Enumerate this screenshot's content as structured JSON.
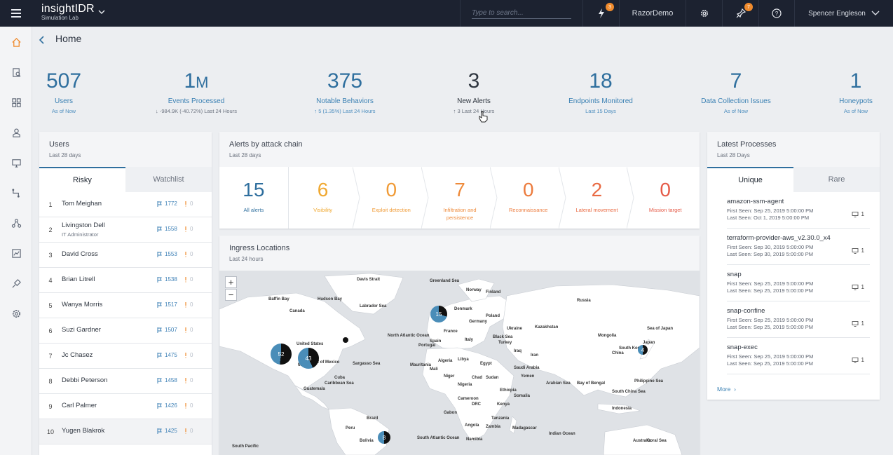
{
  "topbar": {
    "brand_name": "insightIDR",
    "brand_sub": "Simulation Lab",
    "search_placeholder": "Type to search...",
    "alerts_badge": "3",
    "org_name": "RazorDemo",
    "tasks_badge": "7",
    "user_name": "Spencer Engleson"
  },
  "page": {
    "title": "Home"
  },
  "stats": [
    {
      "value": "507",
      "unit": "",
      "label": "Users",
      "sub": "As of Now"
    },
    {
      "value": "1",
      "unit": "M",
      "label": "Events Processed",
      "sub": "↓ -984.9K (-40.72%)   Last 24 Hours"
    },
    {
      "value": "375",
      "unit": "",
      "label": "Notable Behaviors",
      "sub": "↑ 5 (1.35%)   Last 24 Hours"
    },
    {
      "value": "3",
      "unit": "",
      "label": "New Alerts",
      "sub": "↑ 3   Last 24 Hours"
    },
    {
      "value": "18",
      "unit": "",
      "label": "Endpoints Monitored",
      "sub": "Last 15 Days"
    },
    {
      "value": "7",
      "unit": "",
      "label": "Data Collection Issues",
      "sub": "As of Now"
    },
    {
      "value": "1",
      "unit": "",
      "label": "Honeypots",
      "sub": "As of Now"
    }
  ],
  "users_card": {
    "title": "Users",
    "sub": "Last 28 days",
    "tab_risky": "Risky",
    "tab_watchlist": "Watchlist",
    "rows": [
      {
        "idx": "1",
        "name": "Tom Meighan",
        "role": "",
        "flags": "1772",
        "alerts": "0"
      },
      {
        "idx": "2",
        "name": "Livingston Dell",
        "role": "IT Administrator",
        "flags": "1558",
        "alerts": "0"
      },
      {
        "idx": "3",
        "name": "David Cross",
        "role": "",
        "flags": "1553",
        "alerts": "0"
      },
      {
        "idx": "4",
        "name": "Brian Litrell",
        "role": "",
        "flags": "1538",
        "alerts": "0"
      },
      {
        "idx": "5",
        "name": "Wanya Morris",
        "role": "",
        "flags": "1517",
        "alerts": "0"
      },
      {
        "idx": "6",
        "name": "Suzi Gardner",
        "role": "",
        "flags": "1507",
        "alerts": "0"
      },
      {
        "idx": "7",
        "name": "Jc Chasez",
        "role": "",
        "flags": "1475",
        "alerts": "0"
      },
      {
        "idx": "8",
        "name": "Debbi Peterson",
        "role": "",
        "flags": "1458",
        "alerts": "0"
      },
      {
        "idx": "9",
        "name": "Carl Palmer",
        "role": "",
        "flags": "1426",
        "alerts": "0"
      },
      {
        "idx": "10",
        "name": "Yugen Blakrok",
        "role": "",
        "flags": "1425",
        "alerts": "0"
      }
    ]
  },
  "attack_chain": {
    "title": "Alerts by attack chain",
    "sub": "Last 28 days",
    "items": [
      {
        "count": "15",
        "label": "All alerts",
        "color": "#2f6f9e"
      },
      {
        "count": "6",
        "label": "Visibility",
        "color": "#f0a830"
      },
      {
        "count": "0",
        "label": "Exploit detection",
        "color": "#f09a35"
      },
      {
        "count": "7",
        "label": "Infiltration and persistence",
        "color": "#ee8a3a"
      },
      {
        "count": "0",
        "label": "Reconnaissance",
        "color": "#ec7b3d"
      },
      {
        "count": "2",
        "label": "Lateral movement",
        "color": "#e96a42"
      },
      {
        "count": "0",
        "label": "Mission target",
        "color": "#e55a47"
      }
    ]
  },
  "ingress": {
    "title": "Ingress Locations",
    "sub": "Last 24 hours",
    "zoom_in": "+",
    "zoom_out": "−",
    "clusters": [
      {
        "count": "52"
      },
      {
        "count": "43"
      },
      {
        "count": "15"
      },
      {
        "count": "4"
      },
      {
        "count": "8"
      }
    ],
    "labels": [
      "Davis Strait",
      "Baffin Bay",
      "Hudson Bay",
      "Labrador Sea",
      "Canada",
      "North Atlantic Ocean",
      "United States",
      "Mexico",
      "Gulf of Mexico",
      "Sargasso Sea",
      "Caribbean Sea",
      "Brazil",
      "Peru",
      "Bolivia",
      "Greenland Sea",
      "Norway",
      "Finland",
      "Denmark",
      "Germany",
      "Poland",
      "Ukraine",
      "France",
      "Spain",
      "Italy",
      "Turkey",
      "Kazakhstan",
      "Russia",
      "Mongolia",
      "China",
      "Iran",
      "Iraq",
      "Egypt",
      "Libya",
      "Algeria",
      "Niger",
      "Sudan",
      "Ethiopia",
      "Kenya",
      "Tanzania",
      "DRC",
      "Angola",
      "Namibia",
      "Arabian Sea",
      "Bay of Bengal",
      "Philippine Sea",
      "South China Sea",
      "Indonesia",
      "Indian Ocean",
      "Australia",
      "Coral Sea",
      "Japan",
      "South Korea",
      "Sea of Japan",
      "South Atlantic Ocean",
      "Somalia",
      "Yemen",
      "Saudi Arabia",
      "Madagascar",
      "Black Sea",
      "Mauritania",
      "Mali",
      "Nigeria",
      "Chad",
      "Cameroon",
      "Gabon",
      "Zambia",
      "South Pacific",
      "Portugal",
      "Cuba",
      "Guatemala"
    ]
  },
  "processes": {
    "title": "Latest Processes",
    "sub": "Last 28 Days",
    "tab_unique": "Unique",
    "tab_rare": "Rare",
    "rows": [
      {
        "name": "amazon-ssm-agent",
        "first": "First Seen: Sep 25, 2019 5:00:00 PM",
        "last": "Last Seen: Oct 1, 2019 5:00:00 PM",
        "count": "1"
      },
      {
        "name": "terraform-provider-aws_v2.30.0_x4",
        "first": "First Seen: Sep 30, 2019 5:00:00 PM",
        "last": "Last Seen: Sep 30, 2019 5:00:00 PM",
        "count": "1"
      },
      {
        "name": "snap",
        "first": "First Seen: Sep 25, 2019 5:00:00 PM",
        "last": "Last Seen: Sep 25, 2019 5:00:00 PM",
        "count": "1"
      },
      {
        "name": "snap-confine",
        "first": "First Seen: Sep 25, 2019 5:00:00 PM",
        "last": "Last Seen: Sep 25, 2019 5:00:00 PM",
        "count": "1"
      },
      {
        "name": "snap-exec",
        "first": "First Seen: Sep 25, 2019 5:00:00 PM",
        "last": "Last Seen: Sep 25, 2019 5:00:00 PM",
        "count": "1"
      }
    ],
    "more_label": "More"
  },
  "colors": {
    "accent": "#2f6f9e",
    "topbar": "#1c2230",
    "badge": "#f08b2d",
    "cluster_blue": "#4a8db8",
    "cluster_dark": "#111111"
  }
}
